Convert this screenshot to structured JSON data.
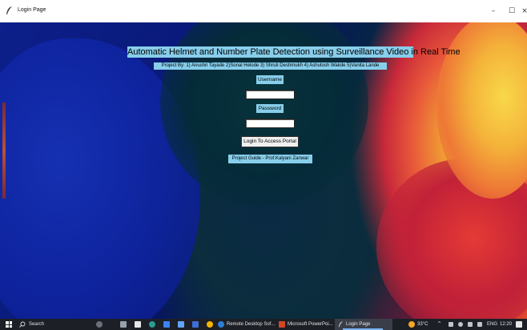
{
  "window": {
    "title": "Login Page",
    "controls": {
      "minimize": "–",
      "maximize": "☐",
      "close": "×"
    }
  },
  "form": {
    "title": "Automatic Helmet and Number Plate Detection using Surveillance Video in Real Time",
    "project_by": "Project By: 1) Anushri Tayade 2)Sonal Helode 3) Shruti Deshmukh 4) Ashutosh Wakde  5)Vanita Lande",
    "username_label": "Username",
    "username_value": "",
    "password_label": "Password",
    "password_value": "",
    "login_button": "Login To Access Portal",
    "guide": "Project Guide  - Prof.Kalyani Zanwar"
  },
  "taskbar": {
    "search_label": "Search",
    "apps": [
      {
        "label": "Remote Desktop Sof...",
        "icon": "remote-desktop-icon",
        "color": "#2f7fd8"
      },
      {
        "label": "Microsoft PowerPoi...",
        "icon": "powerpoint-icon",
        "color": "#d24726"
      },
      {
        "label": "Login Page",
        "icon": "feather-icon",
        "color": "#cfd3db"
      }
    ],
    "weather": "33°C",
    "language": "ENG",
    "time": "12:20"
  },
  "colors": {
    "label_bg": "#87ceeb",
    "taskbar_bg": "#1c1f26",
    "wallpaper_blue": "#0c1f8a",
    "wallpaper_orange": "#f1a233"
  }
}
